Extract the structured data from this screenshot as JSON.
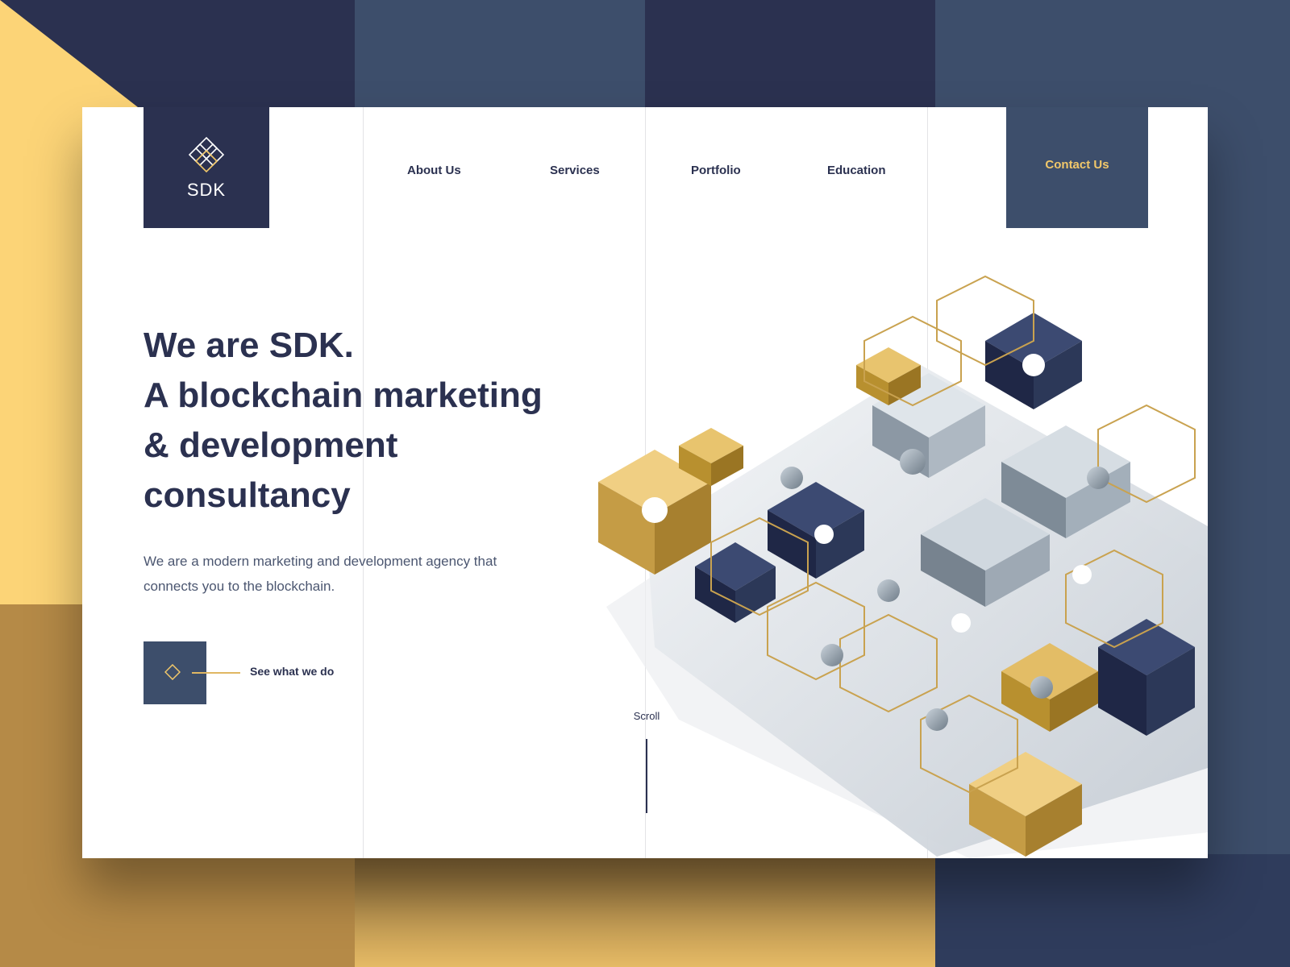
{
  "brand": {
    "name": "SDK",
    "accent_gold": "#f2c86a",
    "navy": "#2b3150",
    "slate": "#3d4e6b"
  },
  "nav": {
    "about": "About Us",
    "services": "Services",
    "portfolio": "Portfolio",
    "education": "Education",
    "contact": "Contact Us"
  },
  "hero": {
    "title_lines": [
      "We are SDK.",
      "A blockchain marketing",
      "& development",
      "consultancy"
    ],
    "subtitle": "We are a modern marketing and development agency that connects you to the blockchain.",
    "cta": "See what we do"
  },
  "scroll": {
    "label": "Scroll"
  },
  "icons": {
    "logo": "interlocked-diamonds-logo-icon",
    "cta": "diamond-icon"
  }
}
